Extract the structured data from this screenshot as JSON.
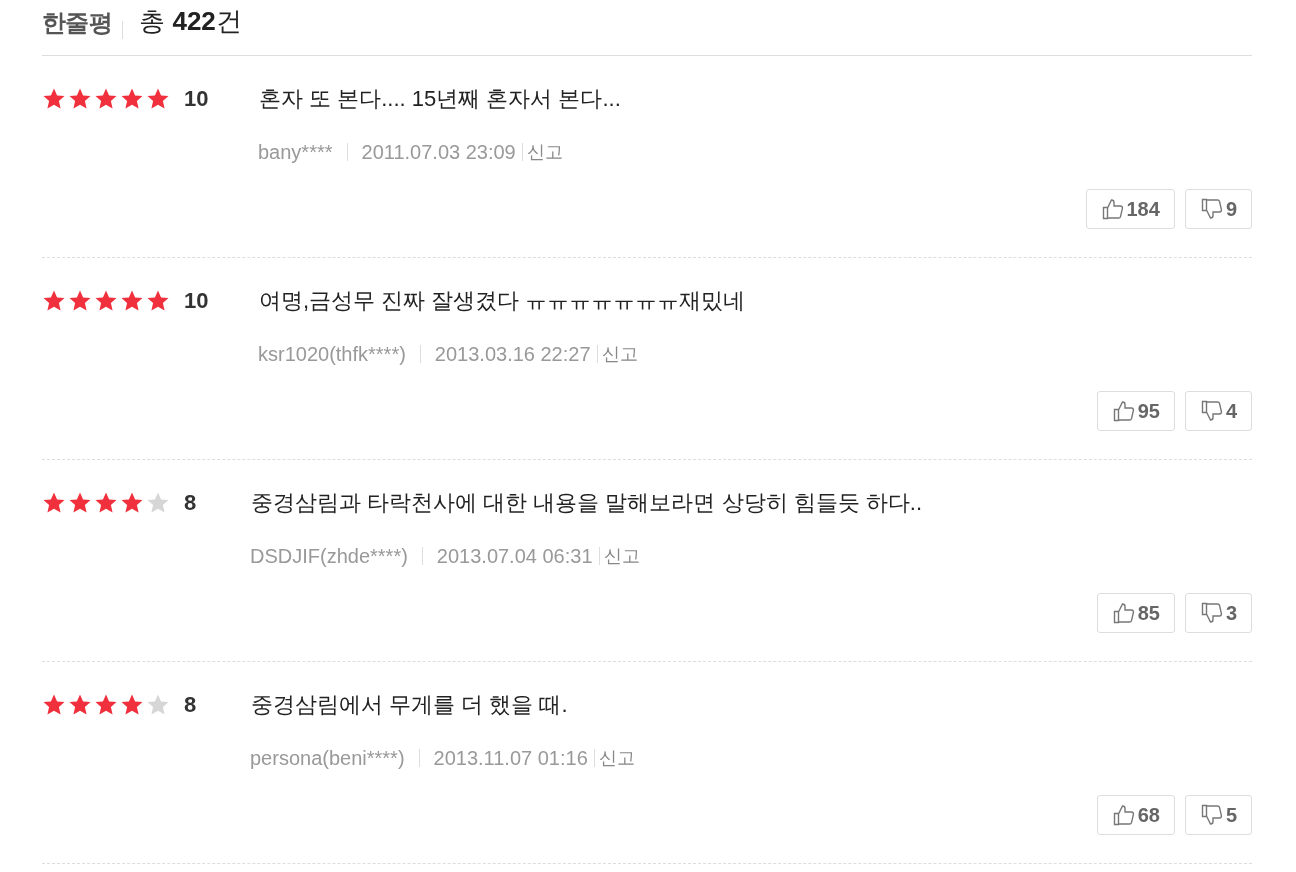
{
  "header": {
    "title": "한줄평",
    "total_prefix": "총",
    "total_count": "422",
    "total_suffix": "건"
  },
  "reviews": [
    {
      "stars": 5,
      "score": "10",
      "text": "혼자 또 본다.... 15년째 혼자서 본다...",
      "author": "bany****",
      "date": "2011.07.03 23:09",
      "report": "신고",
      "likes": "184",
      "dislikes": "9"
    },
    {
      "stars": 5,
      "score": "10",
      "text": "여명,금성무 진짜 잘생겼다 ㅠㅠㅠㅠㅠㅠㅠ재밌네",
      "author": "ksr1020(thfk****)",
      "date": "2013.03.16 22:27",
      "report": "신고",
      "likes": "95",
      "dislikes": "4"
    },
    {
      "stars": 4,
      "score": "8",
      "text": "중경삼림과 타락천사에 대한 내용을 말해보라면 상당히 힘들듯 하다..",
      "author": "DSDJIF(zhde****)",
      "date": "2013.07.04 06:31",
      "report": "신고",
      "likes": "85",
      "dislikes": "3"
    },
    {
      "stars": 4,
      "score": "8",
      "text": "중경삼림에서 무게를 더 했을 때.",
      "author": "persona(beni****)",
      "date": "2013.11.07 01:16",
      "report": "신고",
      "likes": "68",
      "dislikes": "5"
    }
  ]
}
